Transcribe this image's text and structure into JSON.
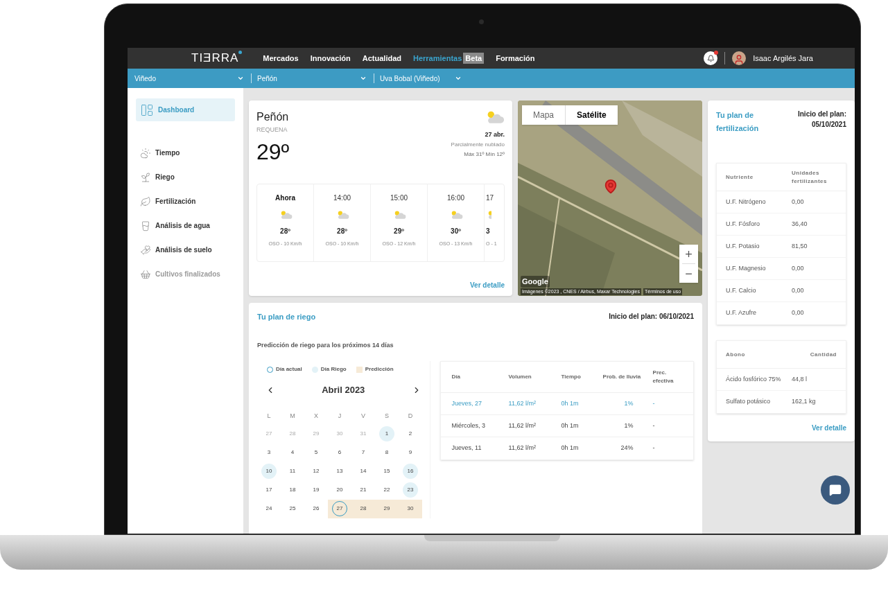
{
  "nav": {
    "logo": "TIƎRRA",
    "items": [
      {
        "label": "Mercados",
        "selected": false
      },
      {
        "label": "Innovación",
        "selected": false
      },
      {
        "label": "Actualidad",
        "selected": false
      },
      {
        "label": "Herramientas",
        "selected": true,
        "badge": "Beta"
      },
      {
        "label": "Formación",
        "selected": false
      }
    ],
    "notifications": {
      "unread": true
    },
    "user": {
      "name": "Isaac Argilés Jara"
    }
  },
  "filters": [
    {
      "label": "Viñedo"
    },
    {
      "label": "Peñón"
    },
    {
      "label": "Uva Bobal (Viñedo)"
    }
  ],
  "sidebar": {
    "items": [
      {
        "label": "Dashboard",
        "selected": true,
        "disabled": false
      },
      {
        "label": "Tiempo",
        "selected": false,
        "disabled": false
      },
      {
        "label": "Riego",
        "selected": false,
        "disabled": false
      },
      {
        "label": "Fertilización",
        "selected": false,
        "disabled": false
      },
      {
        "label": "Análisis de agua",
        "selected": false,
        "disabled": false
      },
      {
        "label": "Análisis de suelo",
        "selected": false,
        "disabled": false
      },
      {
        "label": "Cultivos finalizados",
        "selected": false,
        "disabled": true
      }
    ]
  },
  "weather": {
    "place": "Peñón",
    "region": "REQUENA",
    "temperature": "29º",
    "date": "27 abr.",
    "condition": "Parcialmente nublado",
    "range": "Máx 31º Mín 12º",
    "hours": [
      {
        "time": "Ahora",
        "temp": "28º",
        "wind": "OSO - 10 Km/h",
        "selected": true
      },
      {
        "time": "14:00",
        "temp": "28º",
        "wind": "OSO - 10 Km/h",
        "selected": false
      },
      {
        "time": "15:00",
        "temp": "29º",
        "wind": "OSO - 12 Km/h",
        "selected": false
      },
      {
        "time": "16:00",
        "temp": "30º",
        "wind": "OSO - 13 Km/h",
        "selected": false
      },
      {
        "time": "17",
        "temp": "3",
        "wind": "O - 1",
        "selected": false
      }
    ],
    "link": "Ver detalle"
  },
  "map": {
    "tabs": [
      {
        "label": "Mapa",
        "selected": false
      },
      {
        "label": "Satélite",
        "selected": true
      }
    ],
    "zoom_in": "+",
    "zoom_out": "−",
    "logo": "Google",
    "attribution": "Imágenes ©2023 , CNES / Airbus, Maxar Technologies",
    "terms": "Términos de uso"
  },
  "fertilization": {
    "title": "Tu plan de fertilización",
    "start_label": "Inicio del plan:",
    "start_date": "05/10/2021",
    "nutrients": {
      "columns": [
        "Nutriente",
        "Unidades fertilizantes"
      ],
      "rows": [
        [
          "U.F. Nitrógeno",
          "0,00"
        ],
        [
          "U.F. Fósforo",
          "36,40"
        ],
        [
          "U.F. Potasio",
          "81,50"
        ],
        [
          "U.F. Magnesio",
          "0,00"
        ],
        [
          "U.F. Calcio",
          "0,00"
        ],
        [
          "U.F. Azufre",
          "0,00"
        ]
      ]
    },
    "fertilizers": {
      "columns": [
        "Abono",
        "Cantidad"
      ],
      "rows": [
        [
          "Ácido fosfórico 75%",
          "44,8 l"
        ],
        [
          "Sulfato potásico",
          "162,1 kg"
        ]
      ]
    },
    "link": "Ver detalle"
  },
  "irrigation": {
    "title": "Tu plan de riego",
    "start": "Inicio del plan: 06/10/2021",
    "subtitle": "Predicción de riego para los próximos 14 días",
    "legend": [
      {
        "kind": "current",
        "label": "Día actual"
      },
      {
        "kind": "riego",
        "label": "Día Riego"
      },
      {
        "kind": "prediction",
        "label": "Predicción"
      }
    ],
    "calendar": {
      "month": "Abril 2023",
      "weekdays": [
        "L",
        "M",
        "X",
        "J",
        "V",
        "S",
        "D"
      ],
      "weeks": [
        [
          {
            "label": "27",
            "outside": true,
            "riego": false,
            "prediction": false,
            "current": false
          },
          {
            "label": "28",
            "outside": true,
            "riego": false,
            "prediction": false,
            "current": false
          },
          {
            "label": "29",
            "outside": true,
            "riego": false,
            "prediction": false,
            "current": false
          },
          {
            "label": "30",
            "outside": true,
            "riego": false,
            "prediction": false,
            "current": false
          },
          {
            "label": "31",
            "outside": true,
            "riego": false,
            "prediction": false,
            "current": false
          },
          {
            "label": "1",
            "outside": false,
            "riego": true,
            "prediction": false,
            "current": false
          },
          {
            "label": "2",
            "outside": false,
            "riego": false,
            "prediction": false,
            "current": false
          }
        ],
        [
          {
            "label": "3",
            "outside": false,
            "riego": false,
            "prediction": false,
            "current": false
          },
          {
            "label": "4",
            "outside": false,
            "riego": false,
            "prediction": false,
            "current": false
          },
          {
            "label": "5",
            "outside": false,
            "riego": false,
            "prediction": false,
            "current": false
          },
          {
            "label": "6",
            "outside": false,
            "riego": false,
            "prediction": false,
            "current": false
          },
          {
            "label": "7",
            "outside": false,
            "riego": false,
            "prediction": false,
            "current": false
          },
          {
            "label": "8",
            "outside": false,
            "riego": false,
            "prediction": false,
            "current": false
          },
          {
            "label": "9",
            "outside": false,
            "riego": false,
            "prediction": false,
            "current": false
          }
        ],
        [
          {
            "label": "10",
            "outside": false,
            "riego": true,
            "prediction": false,
            "current": false
          },
          {
            "label": "11",
            "outside": false,
            "riego": false,
            "prediction": false,
            "current": false
          },
          {
            "label": "12",
            "outside": false,
            "riego": false,
            "prediction": false,
            "current": false
          },
          {
            "label": "13",
            "outside": false,
            "riego": false,
            "prediction": false,
            "current": false
          },
          {
            "label": "14",
            "outside": false,
            "riego": false,
            "prediction": false,
            "current": false
          },
          {
            "label": "15",
            "outside": false,
            "riego": false,
            "prediction": false,
            "current": false
          },
          {
            "label": "16",
            "outside": false,
            "riego": true,
            "prediction": false,
            "current": false
          }
        ],
        [
          {
            "label": "17",
            "outside": false,
            "riego": false,
            "prediction": false,
            "current": false
          },
          {
            "label": "18",
            "outside": false,
            "riego": false,
            "prediction": false,
            "current": false
          },
          {
            "label": "19",
            "outside": false,
            "riego": false,
            "prediction": false,
            "current": false
          },
          {
            "label": "20",
            "outside": false,
            "riego": false,
            "prediction": false,
            "current": false
          },
          {
            "label": "21",
            "outside": false,
            "riego": false,
            "prediction": false,
            "current": false
          },
          {
            "label": "22",
            "outside": false,
            "riego": false,
            "prediction": false,
            "current": false
          },
          {
            "label": "23",
            "outside": false,
            "riego": true,
            "prediction": false,
            "current": false
          }
        ],
        [
          {
            "label": "24",
            "outside": false,
            "riego": false,
            "prediction": false,
            "current": false
          },
          {
            "label": "25",
            "outside": false,
            "riego": false,
            "prediction": false,
            "current": false
          },
          {
            "label": "26",
            "outside": false,
            "riego": false,
            "prediction": false,
            "current": false
          },
          {
            "label": "27",
            "outside": false,
            "riego": false,
            "prediction": true,
            "current": true
          },
          {
            "label": "28",
            "outside": false,
            "riego": false,
            "prediction": true,
            "current": false
          },
          {
            "label": "29",
            "outside": false,
            "riego": false,
            "prediction": true,
            "current": false
          },
          {
            "label": "30",
            "outside": false,
            "riego": false,
            "prediction": true,
            "current": false
          }
        ]
      ]
    },
    "table": {
      "columns": [
        "Día",
        "Volumen",
        "Tiempo",
        "Prob. de lluvia",
        "Prec. efectiva"
      ],
      "rows": [
        {
          "cells": [
            "Jueves, 27",
            "11,62 l/m²",
            "0h 1m",
            "1%",
            "-"
          ],
          "selected": true
        },
        {
          "cells": [
            "Miércoles, 3",
            "11,62 l/m²",
            "0h 1m",
            "1%",
            "-"
          ],
          "selected": false
        },
        {
          "cells": [
            "Jueves, 11",
            "11,62 l/m²",
            "0h 1m",
            "24%",
            "-"
          ],
          "selected": false
        }
      ]
    }
  }
}
